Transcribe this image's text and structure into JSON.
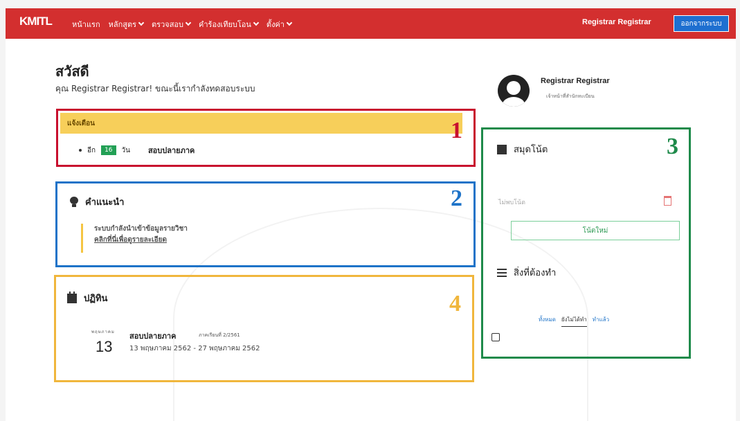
{
  "navbar": {
    "brand": "KMITL",
    "items": [
      {
        "label": "หน้าแรก",
        "dropdown": false
      },
      {
        "label": "หลักสูตร",
        "dropdown": true
      },
      {
        "label": "ตรวจสอบ",
        "dropdown": true
      },
      {
        "label": "คำร้องเทียบโอน",
        "dropdown": true
      },
      {
        "label": "ตั้งค่า",
        "dropdown": true
      }
    ],
    "user": "Registrar Registrar",
    "logout": "ออกจากระบบ",
    "color": "#d32f2f"
  },
  "greeting": {
    "title": "สวัสดี",
    "subtitle": "คุณ Registrar Registrar! ขณะนี้เรากำลังทดสอบระบบ"
  },
  "profile": {
    "name": "Registrar Registrar",
    "role": "เจ้าหน้าที่สำนักทะเบียน"
  },
  "alerts": {
    "number": "1",
    "title": "แจ้งเตือน",
    "prefix": "อีก",
    "days": "16",
    "unit": "วัน",
    "event": "สอบปลายภาค"
  },
  "advice": {
    "number": "2",
    "title": "คำแนะนำ",
    "line1": "ระบบกำลังนำเข้าข้อมูลรายวิชา",
    "link": "คลิกที่นี่เพื่อดูรายละเอียด"
  },
  "calendar": {
    "number": "4",
    "title": "ปฏิทิน",
    "month": "พฤษภาคม",
    "day": "13",
    "event": "สอบปลายภาค",
    "term": "ภาคเรียนที่ 2/2561",
    "range": "13 พฤษภาคม 2562 - 27 พฤษภาคม 2562"
  },
  "notebook": {
    "number": "3",
    "title": "สมุดโน้ต",
    "empty": "ไม่พบโน้ต",
    "new_note": "โน้ตใหม่",
    "todo_title": "สิ่งที่ต้องทำ",
    "filters": [
      "ทั้งหมด",
      "ยังไม่ได้ทำ",
      "ทำแล้ว"
    ]
  },
  "colors": {
    "box1": "#c8102e",
    "box2": "#1e73c8",
    "box3": "#1e8a4a",
    "box4": "#f0b63c"
  }
}
